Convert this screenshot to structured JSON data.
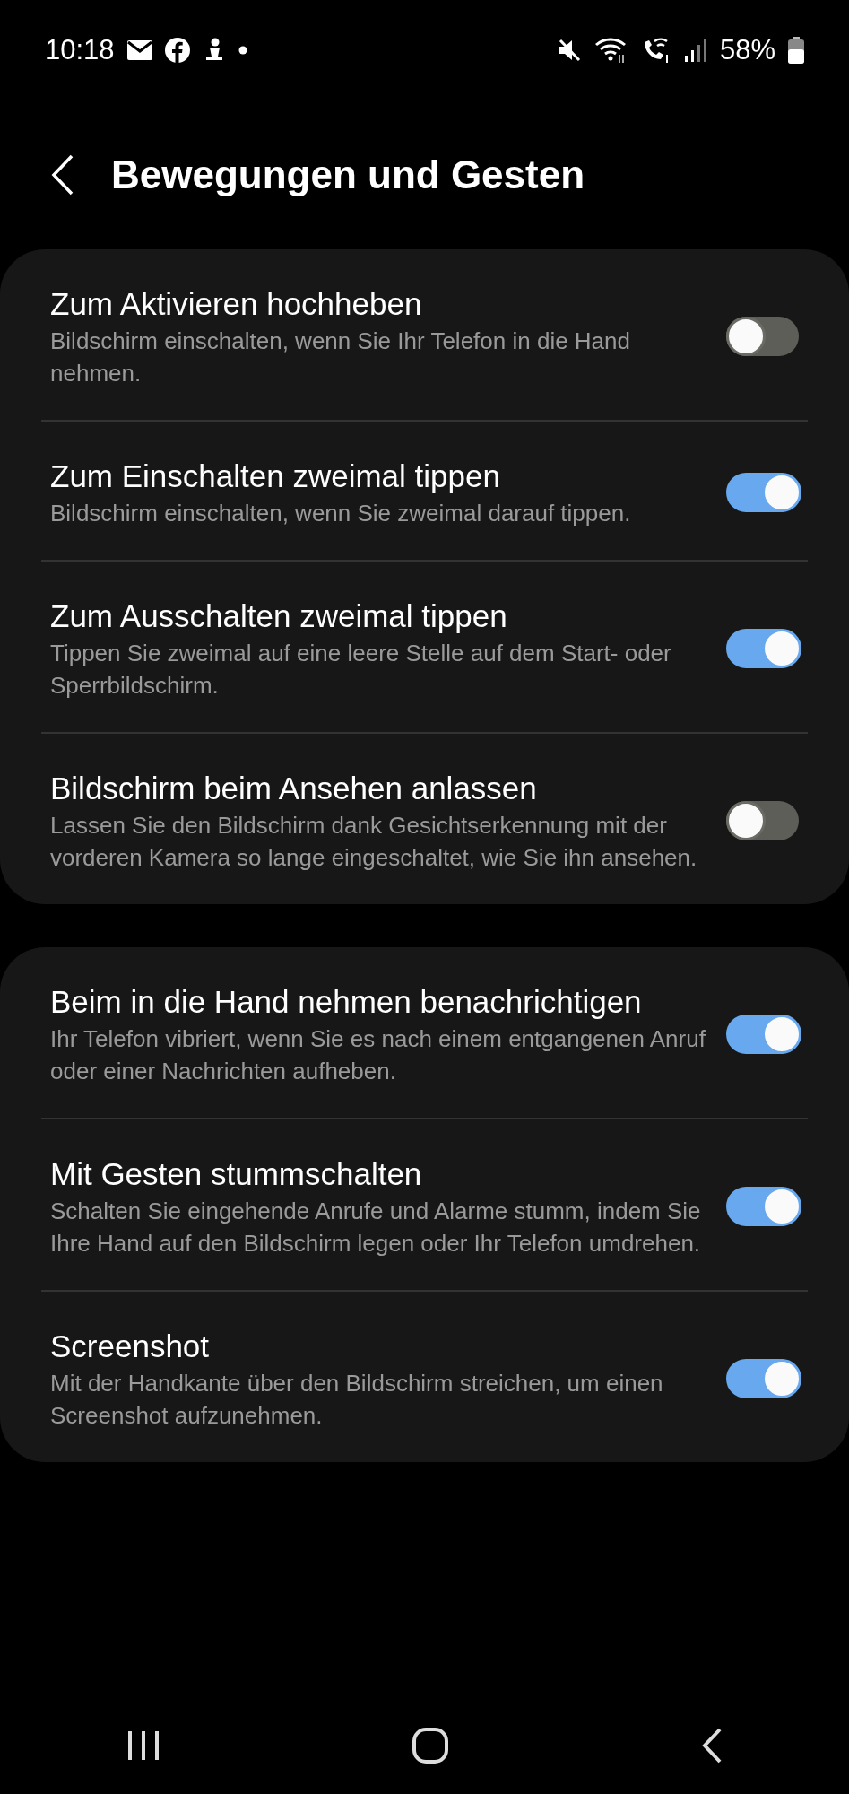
{
  "status_bar": {
    "time": "10:18",
    "battery": "58%"
  },
  "header": {
    "title": "Bewegungen und Gesten"
  },
  "groups": [
    {
      "items": [
        {
          "title": "Zum Aktivieren hochheben",
          "description": "Bildschirm einschalten, wenn Sie Ihr Telefon in die Hand nehmen.",
          "on": false
        },
        {
          "title": "Zum Einschalten zweimal tippen",
          "description": "Bildschirm einschalten, wenn Sie zweimal darauf tippen.",
          "on": true
        },
        {
          "title": "Zum Ausschalten zweimal tippen",
          "description": "Tippen Sie zweimal auf eine leere Stelle auf dem Start- oder Sperrbildschirm.",
          "on": true
        },
        {
          "title": "Bildschirm beim Ansehen anlassen",
          "description": "Lassen Sie den Bildschirm dank Gesichtserkennung mit der vorderen Kamera so lange eingeschaltet, wie Sie ihn ansehen.",
          "on": false
        }
      ]
    },
    {
      "items": [
        {
          "title": "Beim in die Hand nehmen benachrichtigen",
          "description": "Ihr Telefon vibriert, wenn Sie es nach einem entgangenen Anruf oder einer Nachrichten aufheben.",
          "on": true
        },
        {
          "title": "Mit Gesten stummschalten",
          "description": "Schalten Sie eingehende Anrufe und Alarme stumm, indem Sie Ihre Hand auf den Bildschirm legen oder Ihr Telefon umdrehen.",
          "on": true
        },
        {
          "title": "Screenshot",
          "description": "Mit der Handkante über den Bildschirm streichen, um einen Screenshot aufzunehmen.",
          "on": true
        }
      ]
    }
  ]
}
